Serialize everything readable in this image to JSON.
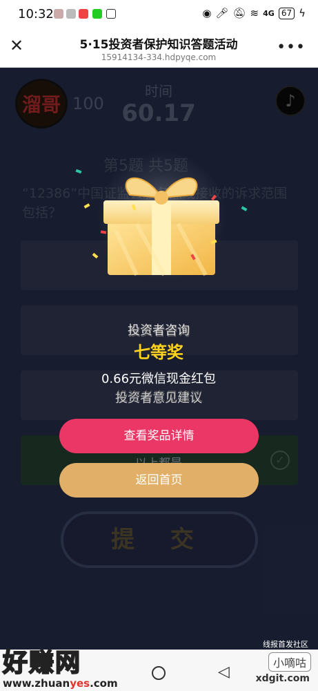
{
  "statusbar": {
    "time": "10:32",
    "network": "4G",
    "battery": "67"
  },
  "header": {
    "title": "5·15投资者保护知识答题活动",
    "url": "15914134-334.hdpyqe.com"
  },
  "quiz": {
    "avatar_text": "溜哥",
    "score": "100",
    "time_label": "时间",
    "time_value": "60.17",
    "question_index": "第5题  共5题",
    "question_text": "“12386”中国证监会服务热线接收的诉求范围包括？",
    "options": [
      "",
      "投资者咨询",
      "投资者意见建议",
      "以上都是"
    ],
    "submit_label": "提 交"
  },
  "prize": {
    "category": "投资者咨询",
    "level": "七等奖",
    "description": "0.66元微信现金红包",
    "sub": "投资者意见建议",
    "view_details_label": "查看奖品详情",
    "back_home_label": "返回首页"
  },
  "watermarks": {
    "left_title": "好赚网",
    "left_url_prefix": "www.zhuan",
    "left_url_highlight": "yes",
    "left_url_suffix": ".com",
    "right_top": "线报首发社区",
    "right_box": "小嘀咕",
    "right_url": "xdgit.com"
  },
  "colors": {
    "pink_button": "#ea3766",
    "gold_button": "#e2af68",
    "prize_level": "#ffd21c"
  }
}
